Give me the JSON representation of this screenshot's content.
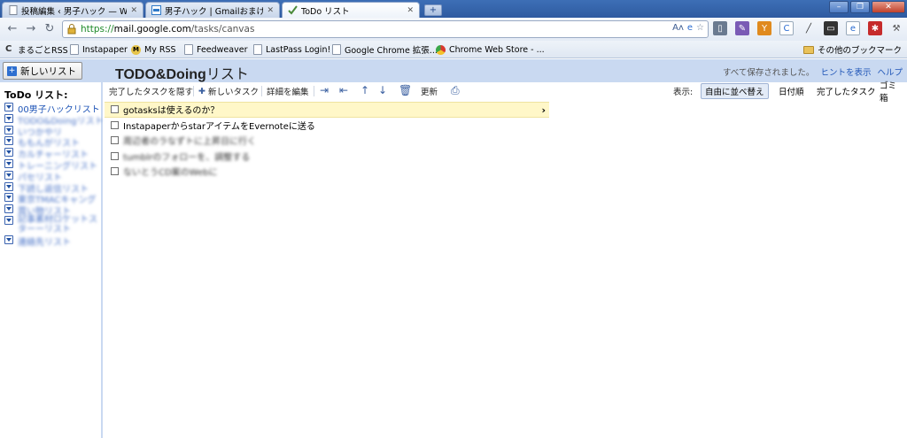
{
  "browser": {
    "tabs": [
      {
        "title": "投稿編集 ‹ 男子ハック — W...",
        "icon": "page-icon",
        "active": false
      },
      {
        "title": "男子ハック | Gmailおまけだっ...",
        "icon": "site-icon",
        "active": false
      },
      {
        "title": "ToDo リスト",
        "icon": "check-icon",
        "active": true
      }
    ],
    "new_tab_label": "+",
    "window_controls": {
      "minimize": "–",
      "maximize": "❐",
      "close": "✕"
    },
    "url": {
      "scheme": "https://",
      "host": "mail.google.com",
      "path": "/tasks/canvas"
    },
    "nav": {
      "back": "←",
      "forward": "→",
      "reload": "↻"
    }
  },
  "bookmarks": {
    "items": [
      {
        "label": "まるごとRSS",
        "icon": "rss-c-icon"
      },
      {
        "label": "Instapaper",
        "icon": "page-icon"
      },
      {
        "label": "My RSS",
        "icon": "m-icon"
      },
      {
        "label": "Feedweaver",
        "icon": "page-icon"
      },
      {
        "label": "LastPass Login!",
        "icon": "page-icon"
      },
      {
        "label": "Google Chrome 拡張...",
        "icon": "page-icon"
      },
      {
        "label": "Chrome Web Store - ...",
        "icon": "chrome-icon"
      }
    ],
    "other": "その他のブックマーク"
  },
  "app": {
    "new_list_button": "新しいリスト",
    "list_title_bold": "TODO&Doing",
    "list_title_rest": "リスト",
    "saved_message": "すべて保存されました。",
    "show_hints": "ヒントを表示",
    "help": "ヘルプ"
  },
  "sidebar": {
    "title": "ToDo リスト:",
    "lists": [
      {
        "label": "00男子ハックリスト",
        "blurred": false
      },
      {
        "label": "TODO&Doingリスト",
        "blurred": true
      },
      {
        "label": "いつかやリ",
        "blurred": true
      },
      {
        "label": "ももんがリスト",
        "blurred": true
      },
      {
        "label": "カルチャーリスト",
        "blurred": true
      },
      {
        "label": "トレーニングリスト",
        "blurred": true
      },
      {
        "label": "パセリスト",
        "blurred": true
      },
      {
        "label": "下読し返信リスト",
        "blurred": true
      },
      {
        "label": "東京TMACキャング",
        "blurred": true
      },
      {
        "label": "買い物リスト",
        "blurred": true
      },
      {
        "label": "記事素材ロケットスターーリスト",
        "blurred": true,
        "two_line": true
      },
      {
        "label": "連絡先リスト",
        "blurred": true
      }
    ]
  },
  "task_toolbar": {
    "hide_completed": "完了したタスクを隠す",
    "new_task": "新しいタスク",
    "edit_details": "詳細を編集",
    "refresh": "更新",
    "view_label": "表示:",
    "sort_manual": "自由に並べ替え",
    "sort_date": "日付順",
    "completed_tasks": "完了したタスク",
    "trash": "ゴミ箱"
  },
  "tasks": [
    {
      "text": "gotasksは使えるのか？",
      "selected": true,
      "blurred": false
    },
    {
      "text": "InstapaperからstarアイテムをEvernoteに送る",
      "selected": false,
      "blurred": false
    },
    {
      "text": "周辺者のラなずトに上昇日に行く",
      "selected": false,
      "blurred": true
    },
    {
      "text": "tumblrのフォローを、調整する",
      "selected": false,
      "blurred": true
    },
    {
      "text": "ないとうCD案のWebに",
      "selected": false,
      "blurred": true
    }
  ],
  "colors": {
    "tab_strip": "#3d6fb6",
    "app_header": "#c9d9f1",
    "link_blue": "#1f55b7",
    "selected_task": "#fff7c8"
  }
}
